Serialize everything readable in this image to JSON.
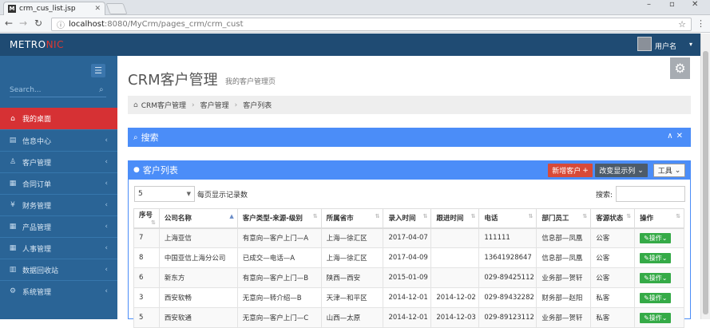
{
  "browser": {
    "tab_title": "crm_cus_list.jsp",
    "url_host": "localhost",
    "url_path": ":8080/MyCrm/pages_crm/crm_cust"
  },
  "header": {
    "logo_main": "METRO",
    "logo_accent": "NIC",
    "user_name": "用户名"
  },
  "sidebar": {
    "search_placeholder": "Search...",
    "items": [
      {
        "label": "我的桌面",
        "icon": "home-icon",
        "active": true
      },
      {
        "label": "信息中心",
        "icon": "info-icon"
      },
      {
        "label": "客户管理",
        "icon": "user-icon"
      },
      {
        "label": "合同订单",
        "icon": "document-icon"
      },
      {
        "label": "财务管理",
        "icon": "yen-icon"
      },
      {
        "label": "产品管理",
        "icon": "grid-icon"
      },
      {
        "label": "人事管理",
        "icon": "grid-icon"
      },
      {
        "label": "数据回收站",
        "icon": "trash-icon"
      },
      {
        "label": "系统管理",
        "icon": "gear-icon"
      }
    ]
  },
  "page": {
    "title": "CRM客户管理",
    "subtitle": "我的客户管理页",
    "breadcrumb": [
      "CRM客户管理",
      "客户管理",
      "客户列表"
    ]
  },
  "search_panel": {
    "title": "搜索"
  },
  "list_panel": {
    "title": "客户列表",
    "add_button": "新增客户",
    "columns_button": "改变显示列",
    "tools_button": "工具",
    "page_size": "5",
    "page_size_label": "每页显示记录数",
    "search_label": "搜索:"
  },
  "table": {
    "headers": [
      "序号",
      "公司名称",
      "客户类型-来源-级别",
      "所属省市",
      "录入时间",
      "跟进时间",
      "电话",
      "部门员工",
      "客源状态",
      "操作"
    ],
    "rows": [
      [
        "7",
        "上海亚信",
        "有意向—客户上门—A",
        "上海—徐汇区",
        "2017-04-07",
        "",
        "111111",
        "信息部—凤凰",
        "公客",
        "操作"
      ],
      [
        "8",
        "中国亚信上海分公司",
        "已成交—电话—A",
        "上海—徐汇区",
        "2017-04-09",
        "",
        "13641928647",
        "信息部—凤凰",
        "公客",
        "操作"
      ],
      [
        "6",
        "新东方",
        "有意向—客户上门—B",
        "陕西—西安",
        "2015-01-09",
        "",
        "029-89425112",
        "业务部—贺轩",
        "公客",
        "操作"
      ],
      [
        "3",
        "西安软畅",
        "无意向—转介绍—B",
        "天津—和平区",
        "2014-12-01",
        "2014-12-02",
        "029-89432282",
        "财务部—赵阳",
        "私客",
        "操作"
      ],
      [
        "5",
        "西安软通",
        "无意向—客户上门—C",
        "山西—太原",
        "2014-12-01",
        "2014-12-03",
        "029-89123112",
        "业务部—贺轩",
        "私客",
        "操作"
      ]
    ]
  }
}
